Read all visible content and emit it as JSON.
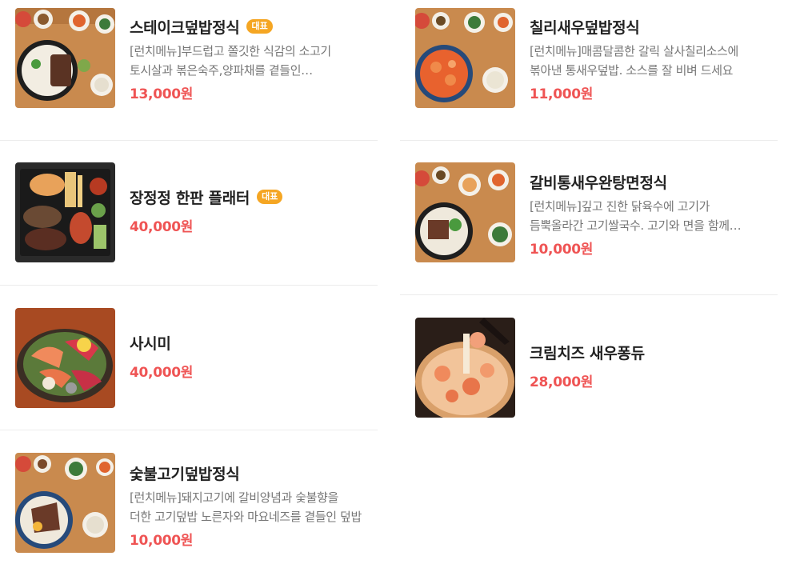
{
  "menu": {
    "badge_label": "대표",
    "currency_suffix": "원",
    "items": [
      {
        "name": "스테이크덮밥정식",
        "badge": "대표",
        "description": "[런치메뉴]부드럽고 쫄깃한 식감의 소고기 토시살과 볶은숙주,양파채를 곁들인 스테이크덮밥",
        "price": "13,000원",
        "image": "steak-rice-bowl-set-photo"
      },
      {
        "name": "장정정 한판 플래터",
        "badge": "대표",
        "description": "",
        "price": "40,000원",
        "image": "grill-platter-photo"
      },
      {
        "name": "사시미",
        "badge": "",
        "description": "",
        "price": "40,000원",
        "image": "sashimi-platter-photo"
      },
      {
        "name": "숯불고기덮밥정식",
        "badge": "",
        "description": "[런치메뉴]돼지고기에 갈비양념과 숯불향을 더한 고기덮밥 노른자와 마요네즈를 곁들인 덮밥",
        "price": "10,000원",
        "image": "charcoal-pork-rice-bowl-set-photo"
      },
      {
        "name": "칠리새우덮밥정식",
        "badge": "",
        "description": "[런치메뉴]매콤달콤한 갈릭 살사칠리소스에 볶아낸 통새우덮밥. 소스를 잘 비벼 드세요",
        "price": "11,000원",
        "image": "chili-shrimp-rice-bowl-set-photo"
      },
      {
        "name": "갈비통새우완탕면정식",
        "badge": "",
        "description": "[런치메뉴]깊고 진한 닭육수에 고기가 듬뿍올라간 고기쌀국수. 고기와 면을 함께 드세요",
        "price": "10,000원",
        "image": "galbi-shrimp-wonton-noodle-set-photo"
      },
      {
        "name": "크림치즈 새우퐁듀",
        "badge": "",
        "description": "",
        "price": "28,000원",
        "image": "cream-cheese-shrimp-fondue-photo"
      }
    ]
  }
}
